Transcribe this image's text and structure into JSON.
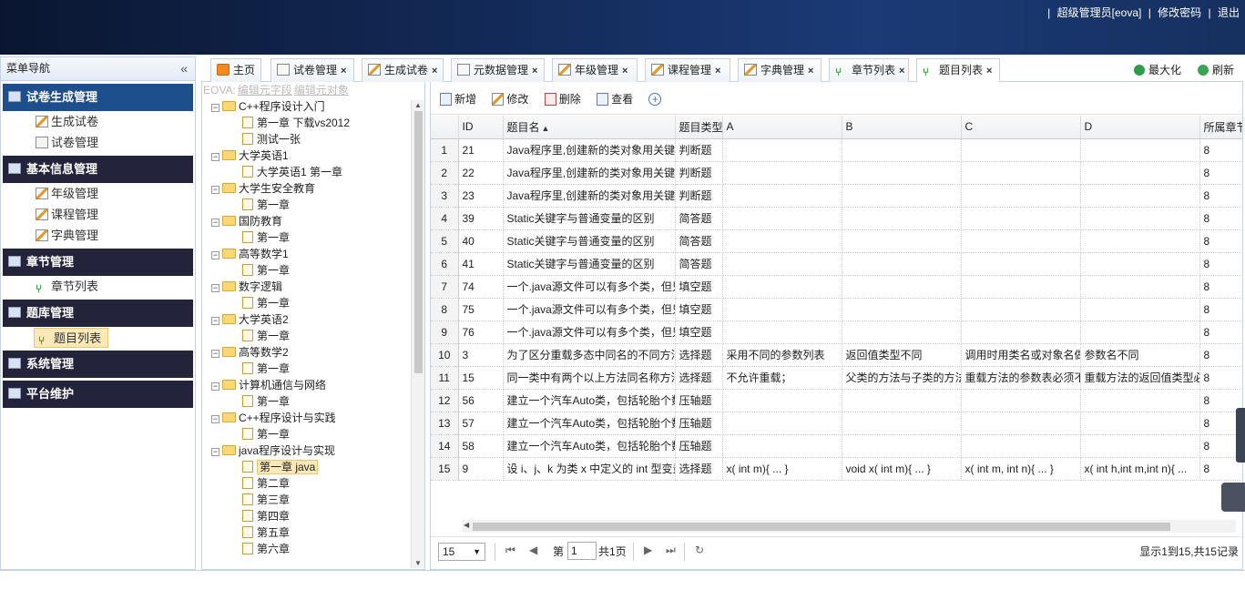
{
  "topbar": {
    "user": "超级管理员[eova]",
    "change_password": "修改密码",
    "logout": "退出"
  },
  "menu": {
    "title": "菜单导航",
    "groups": [
      {
        "label": "试卷生成管理",
        "items": [
          "生成试卷",
          "试卷管理"
        ]
      },
      {
        "label": "基本信息管理",
        "items": [
          "年级管理",
          "课程管理",
          "字典管理"
        ]
      },
      {
        "label": "章节管理",
        "items": [
          "章节列表"
        ]
      },
      {
        "label": "题库管理",
        "items": [
          "题目列表"
        ]
      },
      {
        "label": "系统管理",
        "items": []
      },
      {
        "label": "平台维护",
        "items": []
      }
    ]
  },
  "tabs": [
    "主页",
    "试卷管理",
    "生成试卷",
    "元数据管理",
    "年级管理",
    "课程管理",
    "字典管理",
    "章节列表",
    "题目列表"
  ],
  "tab_tools": {
    "maximize": "最大化",
    "refresh": "刷新"
  },
  "tree": {
    "eova_links": [
      "EOVA:",
      "编辑元字段",
      "编辑元对象"
    ],
    "nodes": [
      {
        "label": "C++程序设计入门",
        "level": 0
      },
      {
        "label": "第一章 下载vs2012",
        "level": 1
      },
      {
        "label": "测试一张",
        "level": 1
      },
      {
        "label": "大学英语1",
        "level": 0
      },
      {
        "label": "大学英语1 第一章",
        "level": 1
      },
      {
        "label": "大学生安全教育",
        "level": 0
      },
      {
        "label": "第一章",
        "level": 1
      },
      {
        "label": "国防教育",
        "level": 0
      },
      {
        "label": "第一章",
        "level": 1
      },
      {
        "label": "高等数学1",
        "level": 0
      },
      {
        "label": "第一章",
        "level": 1
      },
      {
        "label": "数字逻辑",
        "level": 0
      },
      {
        "label": "第一章",
        "level": 1
      },
      {
        "label": "大学英语2",
        "level": 0
      },
      {
        "label": "第一章",
        "level": 1
      },
      {
        "label": "高等数学2",
        "level": 0
      },
      {
        "label": "第一章",
        "level": 1
      },
      {
        "label": "计算机通信与网络",
        "level": 0
      },
      {
        "label": "第一章",
        "level": 1
      },
      {
        "label": "C++程序设计与实践",
        "level": 0
      },
      {
        "label": "第一章",
        "level": 1
      },
      {
        "label": "java程序设计与实现",
        "level": 0
      },
      {
        "label": "第一章 java",
        "level": 1,
        "selected": true
      },
      {
        "label": "第二章",
        "level": 1
      },
      {
        "label": "第三章",
        "level": 1
      },
      {
        "label": "第四章",
        "level": 1
      },
      {
        "label": "第五章",
        "level": 1
      },
      {
        "label": "第六章",
        "level": 1
      }
    ]
  },
  "toolbar": {
    "add": "新增",
    "edit": "修改",
    "delete": "删除",
    "view": "查看"
  },
  "grid": {
    "columns": [
      "ID",
      "题目名",
      "题目类型",
      "A",
      "B",
      "C",
      "D",
      "所属章节"
    ],
    "rows": [
      [
        "21",
        "Java程序里,创建新的类对象用关键字",
        "判断题",
        "",
        "",
        "",
        "",
        "8"
      ],
      [
        "22",
        "Java程序里,创建新的类对象用关键字",
        "判断题",
        "",
        "",
        "",
        "",
        "8"
      ],
      [
        "23",
        "Java程序里,创建新的类对象用关键字",
        "判断题",
        "",
        "",
        "",
        "",
        "8"
      ],
      [
        "39",
        "Static关键字与普通变量的区别",
        "简答题",
        "",
        "",
        "",
        "",
        "8"
      ],
      [
        "40",
        "Static关键字与普通变量的区别",
        "简答题",
        "",
        "",
        "",
        "",
        "8"
      ],
      [
        "41",
        "Static关键字与普通变量的区别",
        "简答题",
        "",
        "",
        "",
        "",
        "8"
      ],
      [
        "74",
        "一个.java源文件可以有多个类，但只",
        "填空题",
        "",
        "",
        "",
        "",
        "8"
      ],
      [
        "75",
        "一个.java源文件可以有多个类，但只",
        "填空题",
        "",
        "",
        "",
        "",
        "8"
      ],
      [
        "76",
        "一个.java源文件可以有多个类，但只",
        "填空题",
        "",
        "",
        "",
        "",
        "8"
      ],
      [
        "3",
        "为了区分重载多态中同名的不同方法",
        "选择题",
        "采用不同的参数列表",
        "返回值类型不同",
        "调用时用类名或对象名做",
        "参数名不同",
        "8"
      ],
      [
        "15",
        "同一类中有两个以上方法同名称方法",
        "选择题",
        "不允许重载；",
        "父类的方法与子类的方法",
        "重载方法的参数表必须不",
        "重载方法的返回值类型必",
        "8"
      ],
      [
        "56",
        "建立一个汽车Auto类，包括轮胎个数",
        "压轴题",
        "",
        "",
        "",
        "",
        "8"
      ],
      [
        "57",
        "建立一个汽车Auto类，包括轮胎个数",
        "压轴题",
        "",
        "",
        "",
        "",
        "8"
      ],
      [
        "58",
        "建立一个汽车Auto类，包括轮胎个数",
        "压轴题",
        "",
        "",
        "",
        "",
        "8"
      ],
      [
        "9",
        "设 i、j、k 为类 x 中定义的 int 型变量",
        "选择题",
        "x( int m){ ... }",
        "void x( int m){ ... }",
        "x( int m, int n){ ... }",
        "x( int h,int m,int n){ ...",
        "8"
      ]
    ]
  },
  "pager": {
    "page_size": "15",
    "page_prefix": "第",
    "page_value": "1",
    "total_pages": "共1页",
    "info": "显示1到15,共15记录"
  }
}
